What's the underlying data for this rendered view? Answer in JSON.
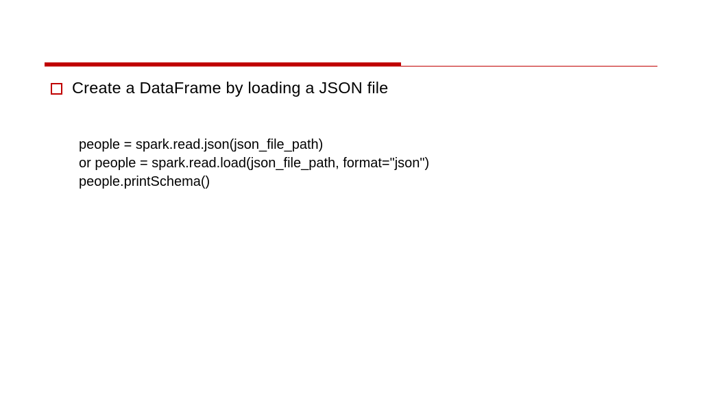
{
  "heading": "Create a DataFrame by loading a JSON file",
  "code": {
    "line1": "people = spark.read.json(json_file_path)",
    "line2": "or people = spark.read.load(json_file_path, format=\"json\")",
    "line3": "people.printSchema()"
  }
}
